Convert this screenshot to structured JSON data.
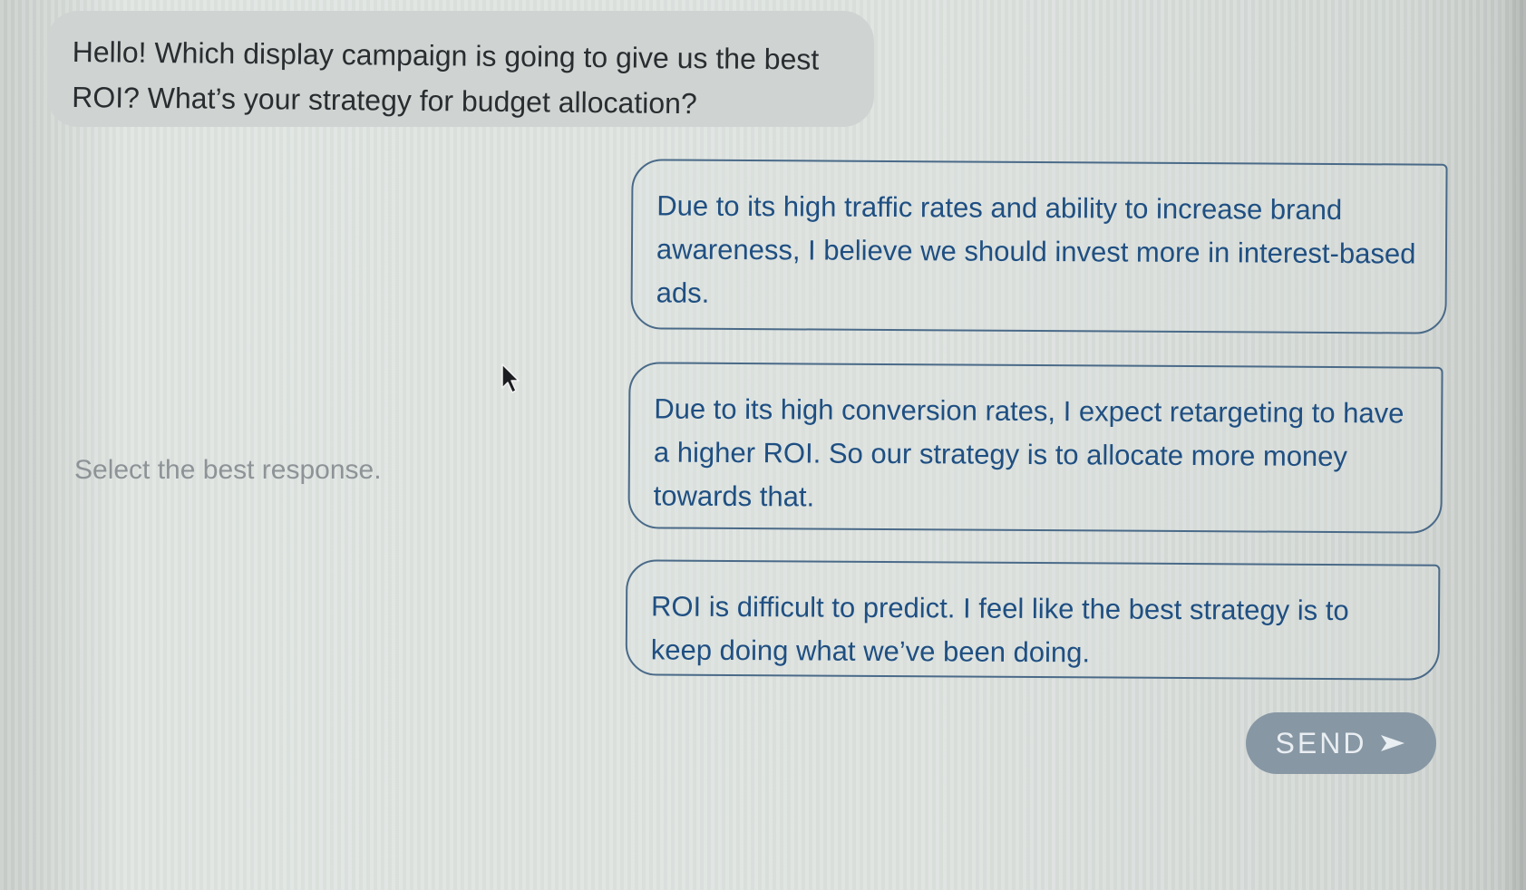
{
  "question": {
    "text": "Hello! Which display campaign is going to give us the best ROI? What’s your strategy for budget allocation?"
  },
  "prompt": {
    "label": "Select the best response."
  },
  "options": [
    {
      "text": "Due to its high traffic rates and ability to increase brand awareness, I believe we should invest more in interest-based ads."
    },
    {
      "text": "Due to its high conversion rates, I expect retargeting to have a higher ROI. So our strategy is to allocate more money towards that."
    },
    {
      "text": "ROI is difficult to predict. I feel like the best strategy is to keep doing what we’ve been doing."
    }
  ],
  "send": {
    "label": "SEND",
    "icon": "send-arrow-icon"
  },
  "colors": {
    "option_text": "#1f4f82",
    "option_border": "#4a6a88",
    "send_button": "#8797a4",
    "question_bubble": "#cfd4d2"
  }
}
